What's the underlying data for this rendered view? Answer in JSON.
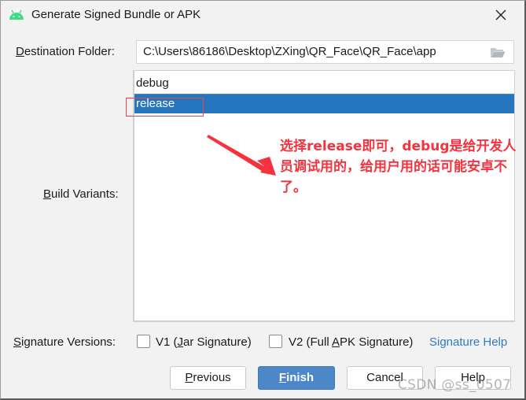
{
  "window": {
    "title": "Generate Signed Bundle or APK",
    "app_icon": "android-icon",
    "close_icon": "close-icon"
  },
  "destination": {
    "label_mnemonic": "D",
    "label_rest": "estination Folder:",
    "value": "C:\\Users\\86186\\Desktop\\ZXing\\QR_Face\\QR_Face\\app",
    "browse_icon": "folder-icon"
  },
  "build_variants": {
    "label_mnemonic": "B",
    "label_rest": "uild Variants:",
    "items": [
      {
        "label": "debug",
        "selected": false
      },
      {
        "label": "release",
        "selected": true
      }
    ]
  },
  "annotation": {
    "text": "选择release即可，debug是给开发人员调试用的，给用户用的话可能安卓不了。",
    "color": "#f5333f"
  },
  "signature": {
    "label_mnemonic": "S",
    "label_rest": "ignature Versions:",
    "v1": {
      "pre": "V1 (",
      "mnemonic": "J",
      "post": "ar Signature)",
      "checked": false
    },
    "v2": {
      "pre": "V2 (Full ",
      "mnemonic": "A",
      "post": "PK Signature)",
      "checked": false
    },
    "help_link": "Signature Help"
  },
  "buttons": {
    "previous": {
      "mnemonic": "P",
      "rest": "revious"
    },
    "finish": {
      "mnemonic": "F",
      "rest": "inish"
    },
    "cancel": "Cancel",
    "help": "Help"
  },
  "colors": {
    "accent": "#4b87c9",
    "selection": "#2675bf",
    "link": "#2f7ac6"
  },
  "watermark": "CSDN @ss_0507"
}
